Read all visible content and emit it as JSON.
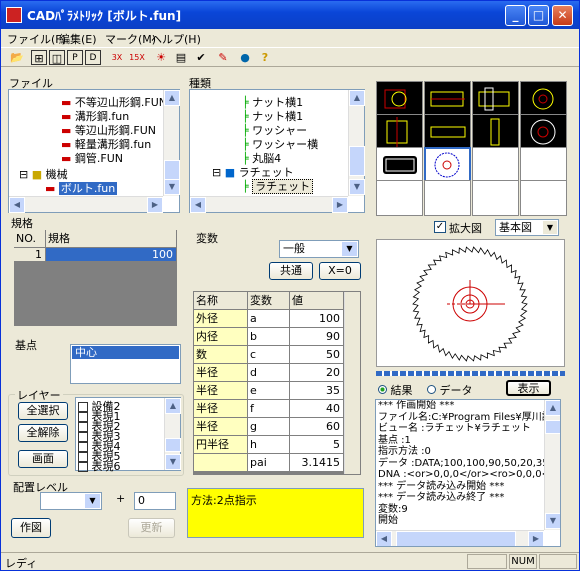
{
  "title": "CADﾊﾟﾗﾒﾄﾘｯｸ [ボルト.fun]",
  "menu": [
    "ファイル(F)",
    "編集(E)",
    "マーク(M)",
    "ヘルプ(H)"
  ],
  "toolbar_icons": [
    "open-icon",
    "grid-icon",
    "split-v-icon",
    "split-h-icon",
    "p-icon",
    "d-icon",
    "3x-icon",
    "15x-icon",
    "sun-icon",
    "table-icon",
    "check-icon",
    "pencil-icon",
    "globe-icon",
    "help-icon"
  ],
  "file_panel": {
    "label": "ファイル",
    "items": [
      "不等辺山形鋼.FUN",
      "溝形鋼.fun",
      "等辺山形鋼.FUN",
      "軽量溝形鋼.fun",
      "鋼管.FUN",
      "機械",
      "ボルト.fun"
    ]
  },
  "type_panel": {
    "label": "種類",
    "items": [
      "ナット横1",
      "ナット横1",
      "ワッシャー",
      "ワッシャー横",
      "丸脳4",
      "ラチェット",
      "ラチェット"
    ]
  },
  "spec": {
    "label": "規格",
    "col_no": "NO.",
    "col_spec": "規格",
    "row_no": "1",
    "row_value": "100"
  },
  "base_point": {
    "label": "基点",
    "value": "中心"
  },
  "layer": {
    "label": "レイヤー",
    "select_all": "全選択",
    "clear_all": "全解除",
    "screen": "画面",
    "items": [
      "設備2",
      "表現1",
      "表現2",
      "表現3",
      "表現4",
      "表現5",
      "表現6"
    ]
  },
  "placement": {
    "label": "配置レベル",
    "plus": "+",
    "value": "0"
  },
  "buttons": {
    "draw": "作図",
    "update": "更新"
  },
  "variables": {
    "label": "変数",
    "combo": "一般",
    "common": "共通",
    "x0": "X=0",
    "headers": [
      "名称",
      "変数",
      "値"
    ],
    "rows": [
      {
        "name": "外径",
        "var": "a",
        "val": "100"
      },
      {
        "name": "内径",
        "var": "b",
        "val": "90"
      },
      {
        "name": "数",
        "var": "c",
        "val": "50"
      },
      {
        "name": "半径",
        "var": "d",
        "val": "20"
      },
      {
        "name": "半径",
        "var": "e",
        "val": "35"
      },
      {
        "name": "半径",
        "var": "f",
        "val": "40"
      },
      {
        "name": "半径",
        "var": "g",
        "val": "60"
      },
      {
        "name": "円半径",
        "var": "h",
        "val": "5"
      },
      {
        "name": "",
        "var": "pai",
        "val": "3.1415"
      }
    ]
  },
  "method_text": "方法:2点指示",
  "preview": {
    "enlarge_label": "拡大図",
    "view_combo": "基本図"
  },
  "output": {
    "radio_result": "結果",
    "radio_data": "データ",
    "display_button": "表示",
    "lines": [
      "*** 作画開始 ***",
      "ファイル名:C:¥Program Files¥厚川設",
      "ビュー名 :ラチェット¥ラチェット",
      "基点 :1",
      "指示方法 :0",
      "データ :DATA;100,100,90,50,20,35,4",
      "DNA :<or>0,0,0</or><ro>0,0,0</",
      "*** データ読み込み開始 ***",
      "*** データ読み込み終了 ***",
      "変数:9",
      "開始"
    ]
  },
  "status": {
    "left": "レディ",
    "num": "NUM"
  },
  "colors": {
    "title_blue": "#0a46d8",
    "highlight": "#316ac5",
    "yellow": "#ffff00"
  }
}
